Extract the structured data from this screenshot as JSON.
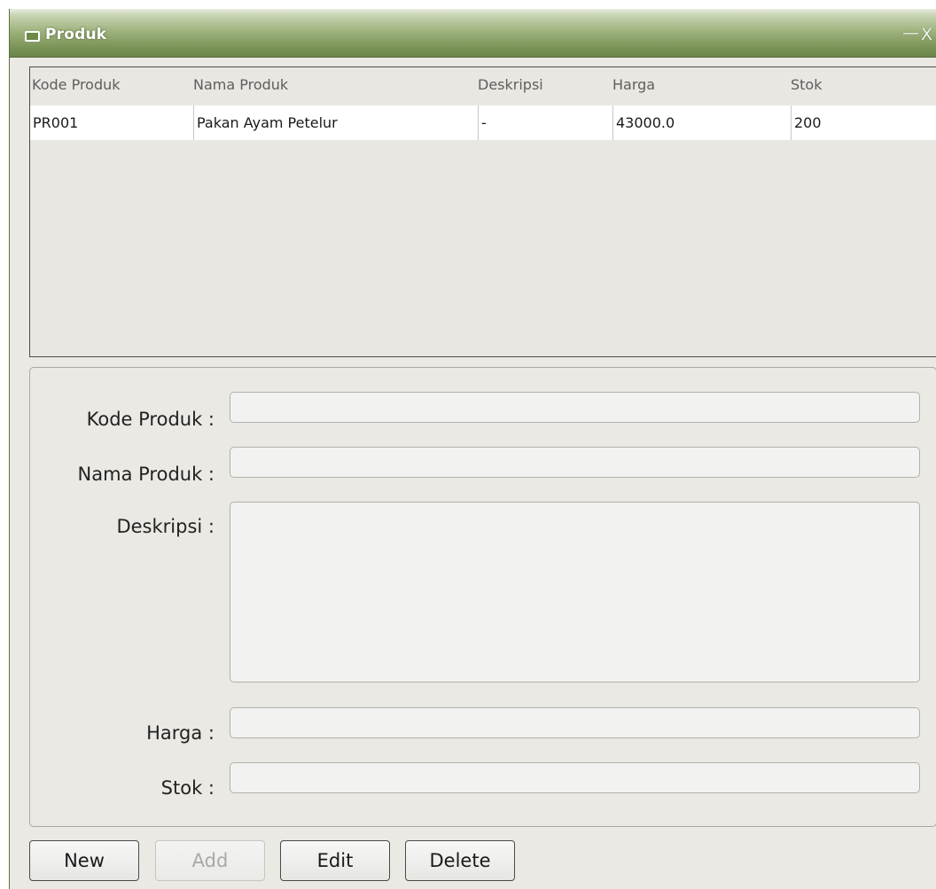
{
  "window": {
    "title": "Produk",
    "minimize_glyph": "—",
    "close_glyph": "X"
  },
  "table": {
    "columns": [
      "Kode Produk",
      "Nama Produk",
      "Deskripsi",
      "Harga",
      "Stok"
    ],
    "rows": [
      [
        "PR001",
        "Pakan Ayam Petelur",
        "-",
        "43000.0",
        "200"
      ]
    ]
  },
  "form": {
    "kode_label": "Kode Produk :",
    "kode_value": "",
    "nama_label": "Nama Produk :",
    "nama_value": "",
    "deskripsi_label": "Deskripsi :",
    "deskripsi_value": "",
    "harga_label": "Harga :",
    "harga_value": "",
    "stok_label": "Stok :",
    "stok_value": ""
  },
  "buttons": {
    "new": "New",
    "add": "Add",
    "edit": "Edit",
    "delete": "Delete"
  },
  "colors": {
    "titlebar": "#7b9457",
    "title_text": "#ffffff"
  }
}
